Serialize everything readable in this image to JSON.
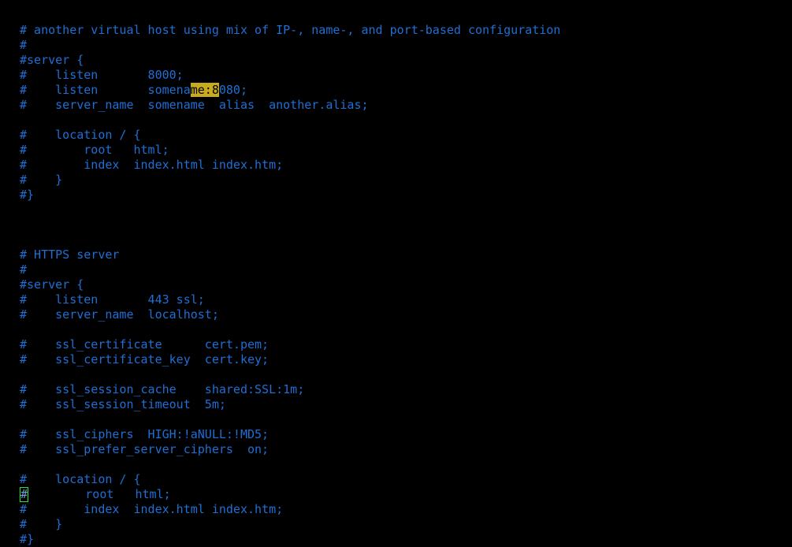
{
  "app": {
    "kind": "terminal-text-editor",
    "file_type": "nginx-config",
    "background_color": "#000000",
    "comment_color": "#1f6fd4",
    "search_highlight_bg": "#c9ab1e",
    "search_highlight_fg": "#000000",
    "cursor_border_color": "#25e725"
  },
  "editor": {
    "search_term": "8080",
    "cursor": {
      "line_index": 31,
      "column_index": 0,
      "char": "#"
    },
    "lines": [
      {
        "index": 0,
        "text": "# another virtual host using mix of IP-, name-, and port-based configuration"
      },
      {
        "index": 1,
        "text": "#"
      },
      {
        "index": 2,
        "text": "#server {"
      },
      {
        "index": 3,
        "text": "#    listen       8000;"
      },
      {
        "index": 4,
        "text": "#    listen       somename:8080;",
        "highlight": {
          "start": 24,
          "end": 28,
          "text": "8080"
        }
      },
      {
        "index": 5,
        "text": "#    server_name  somename  alias  another.alias;"
      },
      {
        "index": 6,
        "text": ""
      },
      {
        "index": 7,
        "text": "#    location / {"
      },
      {
        "index": 8,
        "text": "#        root   html;"
      },
      {
        "index": 9,
        "text": "#        index  index.html index.htm;"
      },
      {
        "index": 10,
        "text": "#    }"
      },
      {
        "index": 11,
        "text": "#}"
      },
      {
        "index": 12,
        "text": ""
      },
      {
        "index": 13,
        "text": ""
      },
      {
        "index": 14,
        "text": ""
      },
      {
        "index": 15,
        "text": "# HTTPS server"
      },
      {
        "index": 16,
        "text": "#"
      },
      {
        "index": 17,
        "text": "#server {"
      },
      {
        "index": 18,
        "text": "#    listen       443 ssl;"
      },
      {
        "index": 19,
        "text": "#    server_name  localhost;"
      },
      {
        "index": 20,
        "text": ""
      },
      {
        "index": 21,
        "text": "#    ssl_certificate      cert.pem;"
      },
      {
        "index": 22,
        "text": "#    ssl_certificate_key  cert.key;"
      },
      {
        "index": 23,
        "text": ""
      },
      {
        "index": 24,
        "text": "#    ssl_session_cache    shared:SSL:1m;"
      },
      {
        "index": 25,
        "text": "#    ssl_session_timeout  5m;"
      },
      {
        "index": 26,
        "text": ""
      },
      {
        "index": 27,
        "text": "#    ssl_ciphers  HIGH:!aNULL:!MD5;"
      },
      {
        "index": 28,
        "text": "#    ssl_prefer_server_ciphers  on;"
      },
      {
        "index": 29,
        "text": ""
      },
      {
        "index": 30,
        "text": "#    location / {"
      },
      {
        "index": 31,
        "text": "#        root   html;",
        "cursor": {
          "start": 0,
          "end": 1,
          "char": "#"
        }
      },
      {
        "index": 32,
        "text": "#        index  index.html index.htm;"
      },
      {
        "index": 33,
        "text": "#    }"
      },
      {
        "index": 34,
        "text": "#}"
      }
    ]
  }
}
